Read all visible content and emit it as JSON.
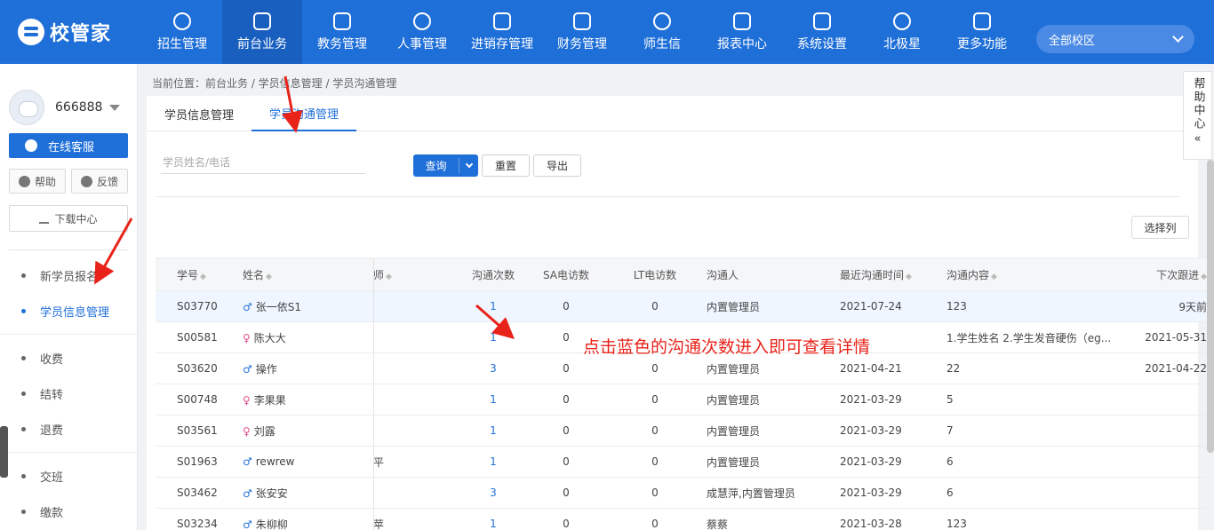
{
  "brand": {
    "name": "校管家"
  },
  "nav": [
    {
      "label": "招生管理",
      "icon": "user-plus-icon"
    },
    {
      "label": "前台业务",
      "icon": "monitor-icon",
      "active": true
    },
    {
      "label": "教务管理",
      "icon": "book-icon"
    },
    {
      "label": "人事管理",
      "icon": "person-icon"
    },
    {
      "label": "进销存管理",
      "icon": "inventory-icon"
    },
    {
      "label": "财务管理",
      "icon": "finance-icon"
    },
    {
      "label": "师生信",
      "icon": "message-icon"
    },
    {
      "label": "报表中心",
      "icon": "report-icon"
    },
    {
      "label": "系统设置",
      "icon": "settings-icon"
    },
    {
      "label": "北极星",
      "icon": "star-icon"
    },
    {
      "label": "更多功能",
      "icon": "more-icon"
    }
  ],
  "campus": {
    "label": "全部校区"
  },
  "user": {
    "name": "666888"
  },
  "sidebar": {
    "service": "在线客服",
    "help": "帮助",
    "feedback": "反馈",
    "download": "下载中心",
    "menu": [
      {
        "label": "新学员报名"
      },
      {
        "label": "学员信息管理",
        "active": true
      },
      {
        "label": "收费"
      },
      {
        "label": "结转"
      },
      {
        "label": "退费"
      },
      {
        "label": "交班"
      },
      {
        "label": "缴款"
      }
    ]
  },
  "breadcrumb": "当前位置：前台业务 / 学员信息管理 / 学员沟通管理",
  "tabs": [
    {
      "label": "学员信息管理"
    },
    {
      "label": "学员沟通管理",
      "active": true
    }
  ],
  "search": {
    "placeholder": "学员姓名/电话"
  },
  "buttons": {
    "query": "查询",
    "reset": "重置",
    "export": "导出",
    "columns": "选择列"
  },
  "table": {
    "headers": {
      "no": "学号",
      "name": "姓名",
      "teacher": "师",
      "count": "沟通次数",
      "sa": "SA电访数",
      "lt": "LT电访数",
      "who": "沟通人",
      "time": "最近沟通时间",
      "content": "沟通内容",
      "next": "下次跟进"
    },
    "rows": [
      {
        "no": "S03770",
        "gender": "male",
        "name": "张一依S1",
        "teacher": "",
        "count": "1",
        "sa": "0",
        "lt": "0",
        "who": "内置管理员",
        "time": "2021-07-24",
        "content": "123",
        "next": "9天前"
      },
      {
        "no": "S00581",
        "gender": "female",
        "name": "陈大大",
        "teacher": "",
        "count": "1",
        "sa": "0",
        "lt": "",
        "who": "",
        "time": "",
        "content": "1.学生姓名 2.学生发音硬伤（eg...",
        "next": "2021-05-31"
      },
      {
        "no": "S03620",
        "gender": "male",
        "name": "操作",
        "teacher": "",
        "count": "3",
        "sa": "0",
        "lt": "0",
        "who": "内置管理员",
        "time": "2021-04-21",
        "content": "22",
        "next": "2021-04-22"
      },
      {
        "no": "S00748",
        "gender": "female",
        "name": "李果果",
        "teacher": "",
        "count": "1",
        "sa": "0",
        "lt": "0",
        "who": "内置管理员",
        "time": "2021-03-29",
        "content": "5",
        "next": ""
      },
      {
        "no": "S03561",
        "gender": "female",
        "name": "刘露",
        "teacher": "",
        "count": "1",
        "sa": "0",
        "lt": "0",
        "who": "内置管理员",
        "time": "2021-03-29",
        "content": "7",
        "next": ""
      },
      {
        "no": "S01963",
        "gender": "male",
        "name": "rewrew",
        "teacher": "平",
        "count": "1",
        "sa": "0",
        "lt": "0",
        "who": "内置管理员",
        "time": "2021-03-29",
        "content": "6",
        "next": ""
      },
      {
        "no": "S03462",
        "gender": "male",
        "name": "张安安",
        "teacher": "",
        "count": "3",
        "sa": "0",
        "lt": "0",
        "who": "成慧萍,内置管理员",
        "time": "2021-03-29",
        "content": "6",
        "next": ""
      },
      {
        "no": "S03234",
        "gender": "male",
        "name": "朱柳柳",
        "teacher": "苹",
        "count": "1",
        "sa": "0",
        "lt": "0",
        "who": "蔡蔡",
        "time": "2021-03-28",
        "content": "123",
        "next": ""
      }
    ]
  },
  "help_panel": {
    "label": "帮助中心"
  },
  "annotation": "点击蓝色的沟通次数进入即可查看详情",
  "colors": {
    "primary": "#1f6fd8",
    "annotation": "#e8231a",
    "female": "#e04c8c"
  }
}
